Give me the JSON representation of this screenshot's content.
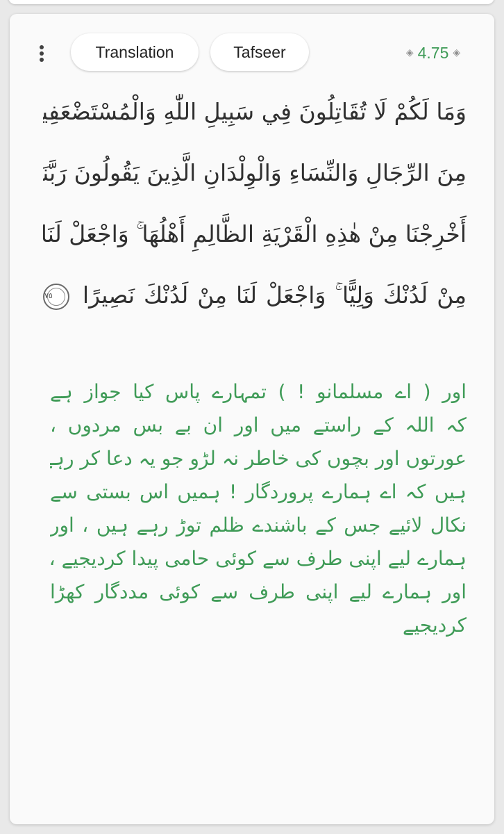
{
  "tabs": {
    "translation": "Translation",
    "tafseer": "Tafseer"
  },
  "verse": {
    "number": "4.75",
    "ayah_marker": "٧٥",
    "arabic_lines": [
      "وَمَا لَكُمْ لَا تُقَاتِلُونَ فِي سَبِيلِ اللّٰهِ وَالْمُسْتَضْعَفِينَ",
      "مِنَ الرِّجَالِ وَالنِّسَاءِ وَالْوِلْدَانِ الَّذِينَ يَقُولُونَ رَبَّنَا",
      "أَخْرِجْنَا مِنْ هٰذِهِ الْقَرْيَةِ الظَّالِمِ أَهْلُهَا ۚ وَاجْعَلْ لَنَا",
      "مِنْ لَدُنْكَ وَلِيًّا ۚ وَاجْعَلْ لَنَا مِنْ لَدُنْكَ نَصِيرًا"
    ],
    "urdu_lines": [
      "اور ( اے مسلمانو ! ) تمہارے پاس کیا جواز ہے",
      "کہ اللہ کے راستے میں اور ان بے بس مردوں ،",
      "عورتوں اور بچوں کی خاطر نہ لڑو جو یہ دعا کر رہے",
      "ہیں کہ اے ہمارے پروردگار ! ہمیں اس بستی سے",
      "نکال لائیے جس کے باشندے ظلم توڑ رہے ہیں ، اور",
      "ہمارے لیے اپنی طرف سے کوئی حامی پیدا کردیجیے ،",
      "اور ہمارے لیے اپنی طرف سے کوئی مددگار کھڑا",
      "کردیجیے"
    ]
  },
  "icons": {
    "more": "more-vertical-icon",
    "ornament_left": "verse-ornament-left-icon",
    "ornament_right": "verse-ornament-right-icon",
    "ayah_end": "ayah-end-marker-icon"
  },
  "colors": {
    "accent_green": "#3f9b57",
    "text_dark": "#2f2f2f",
    "card_bg": "#fafafa",
    "page_bg": "#e9e9e9"
  }
}
